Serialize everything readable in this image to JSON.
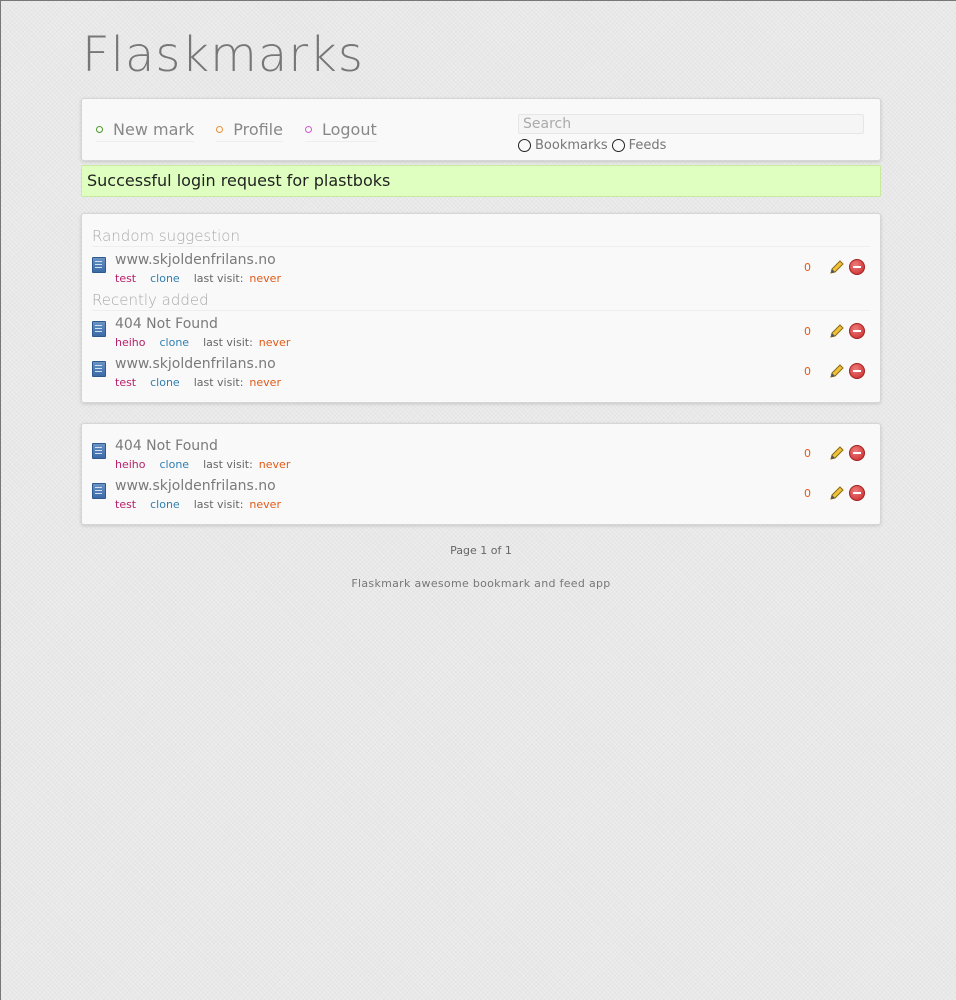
{
  "site": {
    "title": "Flaskmarks"
  },
  "nav": {
    "items": [
      {
        "label": "New mark",
        "dot_color": "#4a9a2a"
      },
      {
        "label": "Profile",
        "dot_color": "#e8903a"
      },
      {
        "label": "Logout",
        "dot_color": "#d35ad3"
      }
    ],
    "search": {
      "placeholder": "Search"
    },
    "search_types": [
      "Bookmarks",
      "Feeds"
    ]
  },
  "flash": {
    "message": "Successful login request for plastboks"
  },
  "random": {
    "heading": "Random suggestion",
    "marks": [
      {
        "title": "www.skjoldenfrilans.no",
        "tag": "test",
        "clone": "clone",
        "last_visit_label": "last visit:",
        "last_visit": "never",
        "clicks": "0"
      }
    ]
  },
  "recent": {
    "heading": "Recently added",
    "marks": [
      {
        "title": "404 Not Found",
        "tag": "heiho",
        "clone": "clone",
        "last_visit_label": "last visit:",
        "last_visit": "never",
        "clicks": "0"
      },
      {
        "title": "www.skjoldenfrilans.no",
        "tag": "test",
        "clone": "clone",
        "last_visit_label": "last visit:",
        "last_visit": "never",
        "clicks": "0"
      }
    ]
  },
  "list": {
    "marks": [
      {
        "title": "404 Not Found",
        "tag": "heiho",
        "clone": "clone",
        "last_visit_label": "last visit:",
        "last_visit": "never",
        "clicks": "0"
      },
      {
        "title": "www.skjoldenfrilans.no",
        "tag": "test",
        "clone": "clone",
        "last_visit_label": "last visit:",
        "last_visit": "never",
        "clicks": "0"
      }
    ]
  },
  "pagination": {
    "text": "Page 1 of 1"
  },
  "footer": {
    "text": "Flaskmark awesome bookmark and feed app"
  }
}
